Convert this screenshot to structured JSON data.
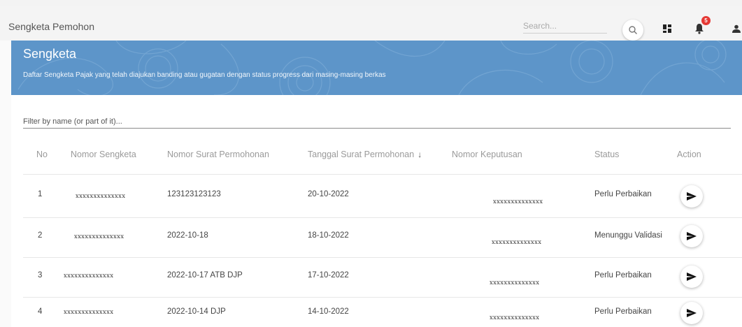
{
  "app": {
    "title": "Sengketa Pemohon"
  },
  "search": {
    "placeholder": "Search..."
  },
  "notifications": {
    "count": "5"
  },
  "banner": {
    "title": "Sengketa",
    "subtitle": "Daftar Sengketa Pajak yang telah diajukan banding atau gugatan dengan status progress dari masing-masing berkas"
  },
  "filter": {
    "placeholder": "Filter by name (or part of it)..."
  },
  "table": {
    "headers": {
      "no": "No",
      "nomor_sengketa": "Nomor Sengketa",
      "nomor_surat": "Nomor Surat Permohonan",
      "tanggal_surat": "Tanggal Surat Permohonan",
      "nomor_keputusan": "Nomor Keputusan",
      "status": "Status",
      "action": "Action"
    },
    "rows": [
      {
        "no": "1",
        "nomor_sengketa": "xxxxxxxxxxxxxx",
        "nomor_surat": "123123123123",
        "tanggal": "20-10-2022",
        "nomor_keputusan": "xxxxxxxxxxxxxx",
        "status": "Perlu Perbaikan"
      },
      {
        "no": "2",
        "nomor_sengketa": "xxxxxxxxxxxxxx",
        "nomor_surat": "2022-10-18",
        "tanggal": "18-10-2022",
        "nomor_keputusan": "xxxxxxxxxxxxxx",
        "status": "Menunggu Validasi"
      },
      {
        "no": "3",
        "nomor_sengketa": "xxxxxxxxxxxxxx",
        "nomor_surat": "2022-10-17 ATB DJP",
        "tanggal": "17-10-2022",
        "nomor_keputusan": "xxxxxxxxxxxxxx",
        "status": "Perlu Perbaikan"
      },
      {
        "no": "4",
        "nomor_sengketa": "xxxxxxxxxxxxxx",
        "nomor_surat": "2022-10-14 DJP",
        "tanggal": "14-10-2022",
        "nomor_keputusan": "xxxxxxxxxxxxxx",
        "status": "Perlu Perbaikan"
      }
    ]
  },
  "colors": {
    "banner": "#5d95c9",
    "badge": "#e53935"
  },
  "icons": {
    "search": "search-icon",
    "apps": "apps-grid-icon",
    "bell": "bell-icon",
    "user": "user-icon",
    "send": "send-icon",
    "sort": "arrow-down-icon"
  }
}
